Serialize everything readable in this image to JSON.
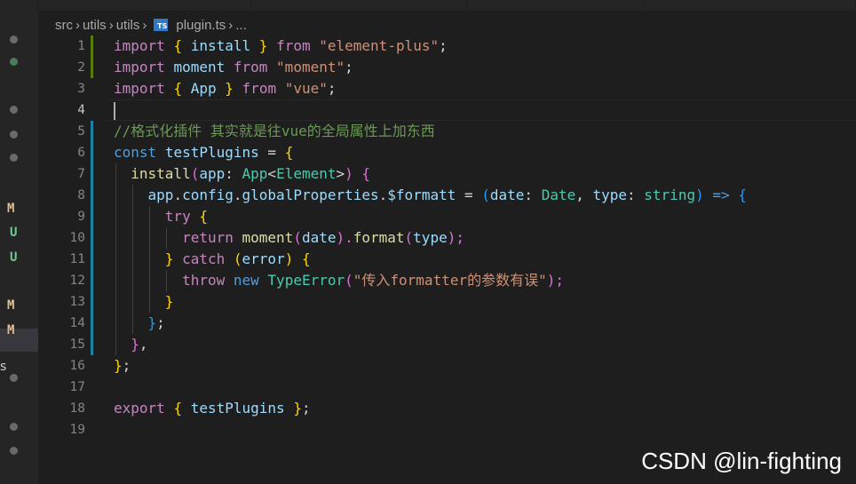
{
  "breadcrumb": {
    "parts": [
      "src",
      "utils",
      "utils"
    ],
    "file_icon": "TS",
    "file": "plugin.ts",
    "ellipsis": "..."
  },
  "sidebar": {
    "markers": [
      "M",
      "U",
      "U",
      "M",
      "M"
    ],
    "cut_text": "s"
  },
  "editor": {
    "line_numbers": [
      "1",
      "2",
      "3",
      "4",
      "5",
      "6",
      "7",
      "8",
      "9",
      "10",
      "11",
      "12",
      "13",
      "14",
      "15",
      "16",
      "17",
      "18",
      "19"
    ],
    "lines": {
      "l1": [
        "import",
        " ",
        "{",
        " ",
        "install",
        " ",
        "}",
        " ",
        "from",
        " ",
        "\"element-plus\"",
        ";"
      ],
      "l2": [
        "import",
        " ",
        "moment",
        " ",
        "from",
        " ",
        "\"moment\"",
        ";"
      ],
      "l3": [
        "import",
        " ",
        "{",
        " ",
        "App",
        " ",
        "}",
        " ",
        "from",
        " ",
        "\"vue\"",
        ";"
      ],
      "l5": [
        "//格式化插件 其实就是往vue的全局属性上加东西"
      ],
      "l6": [
        "const",
        " ",
        "testPlugins",
        " = ",
        "{"
      ],
      "l7": [
        "  ",
        "install",
        "(",
        "app",
        ": ",
        "App",
        "<",
        "Element",
        ">",
        ")",
        " ",
        "{"
      ],
      "l8": [
        "    ",
        "app",
        ".",
        "config",
        ".",
        "globalProperties",
        ".",
        "$formatt",
        " = ",
        "(",
        "date",
        ": ",
        "Date",
        ", ",
        "type",
        ": ",
        "string",
        ")",
        " ",
        "=>",
        " ",
        "{"
      ],
      "l9": [
        "      ",
        "try",
        " ",
        "{"
      ],
      "l10": [
        "        ",
        "return",
        " ",
        "moment",
        "(",
        "date",
        ").",
        "format",
        "(",
        "type",
        ");"
      ],
      "l11": [
        "      ",
        "}",
        " ",
        "catch",
        " ",
        "(",
        "error",
        ")",
        " ",
        "{"
      ],
      "l12": [
        "        ",
        "throw",
        " ",
        "new",
        " ",
        "TypeError",
        "(",
        "\"传入formatter的参数有误\"",
        ");"
      ],
      "l13": [
        "      ",
        "}"
      ],
      "l14": [
        "    ",
        "}",
        ";"
      ],
      "l15": [
        "  ",
        "}",
        ","
      ],
      "l16": [
        "}",
        ";"
      ],
      "l18": [
        "export",
        " ",
        "{",
        " ",
        "testPlugins",
        " ",
        "}",
        ";"
      ]
    }
  },
  "watermark": "CSDN @lin-fighting",
  "colors": {
    "keyword_control": "#c586c0",
    "keyword": "#569cd6",
    "string": "#ce9178",
    "variable": "#9cdcfe",
    "function": "#dcdcaa",
    "type": "#4ec9b0",
    "comment": "#6a9955",
    "git_added": "#587c0c",
    "git_modified": "#1b81a8"
  }
}
